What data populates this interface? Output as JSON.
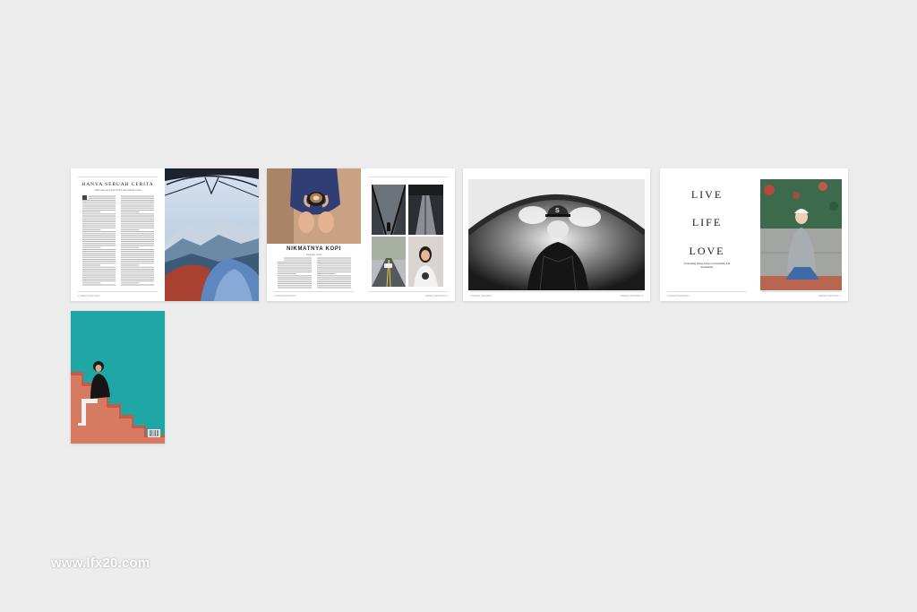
{
  "spread1": {
    "title": "HANYA SEBUAH CERITA",
    "subtitle": "Tidak ada yang lebih indah dari sebuah cerita",
    "folio_left": "1   MAGZ HOLIDAY"
  },
  "spread2": {
    "title": "NIKMATNYA KOPI",
    "subtitle": "Kopi dan cerita",
    "folio_left": "2   MAGZ HOLIDAY",
    "folio_right": "MAGZ HOLIDAY   3"
  },
  "spread3": {
    "folio_left": "4   MAGZ HOLIDAY",
    "folio_right": "MAGZ HOLIDAY   5"
  },
  "spread4": {
    "words": [
      "LIVE",
      "LIFE",
      "LOVE"
    ],
    "caption": "Terkadang hidup hanya soal melihat dan menikmati",
    "folio_left": "6   MAGZ HOLIDAY",
    "folio_right": "MAGZ HOLIDAY   7"
  },
  "watermark": "www.lfx20.com",
  "colors": {
    "background": "#ececec",
    "page": "#ffffff",
    "teal": "#1fa7a6",
    "stairs": "#c85a45"
  }
}
